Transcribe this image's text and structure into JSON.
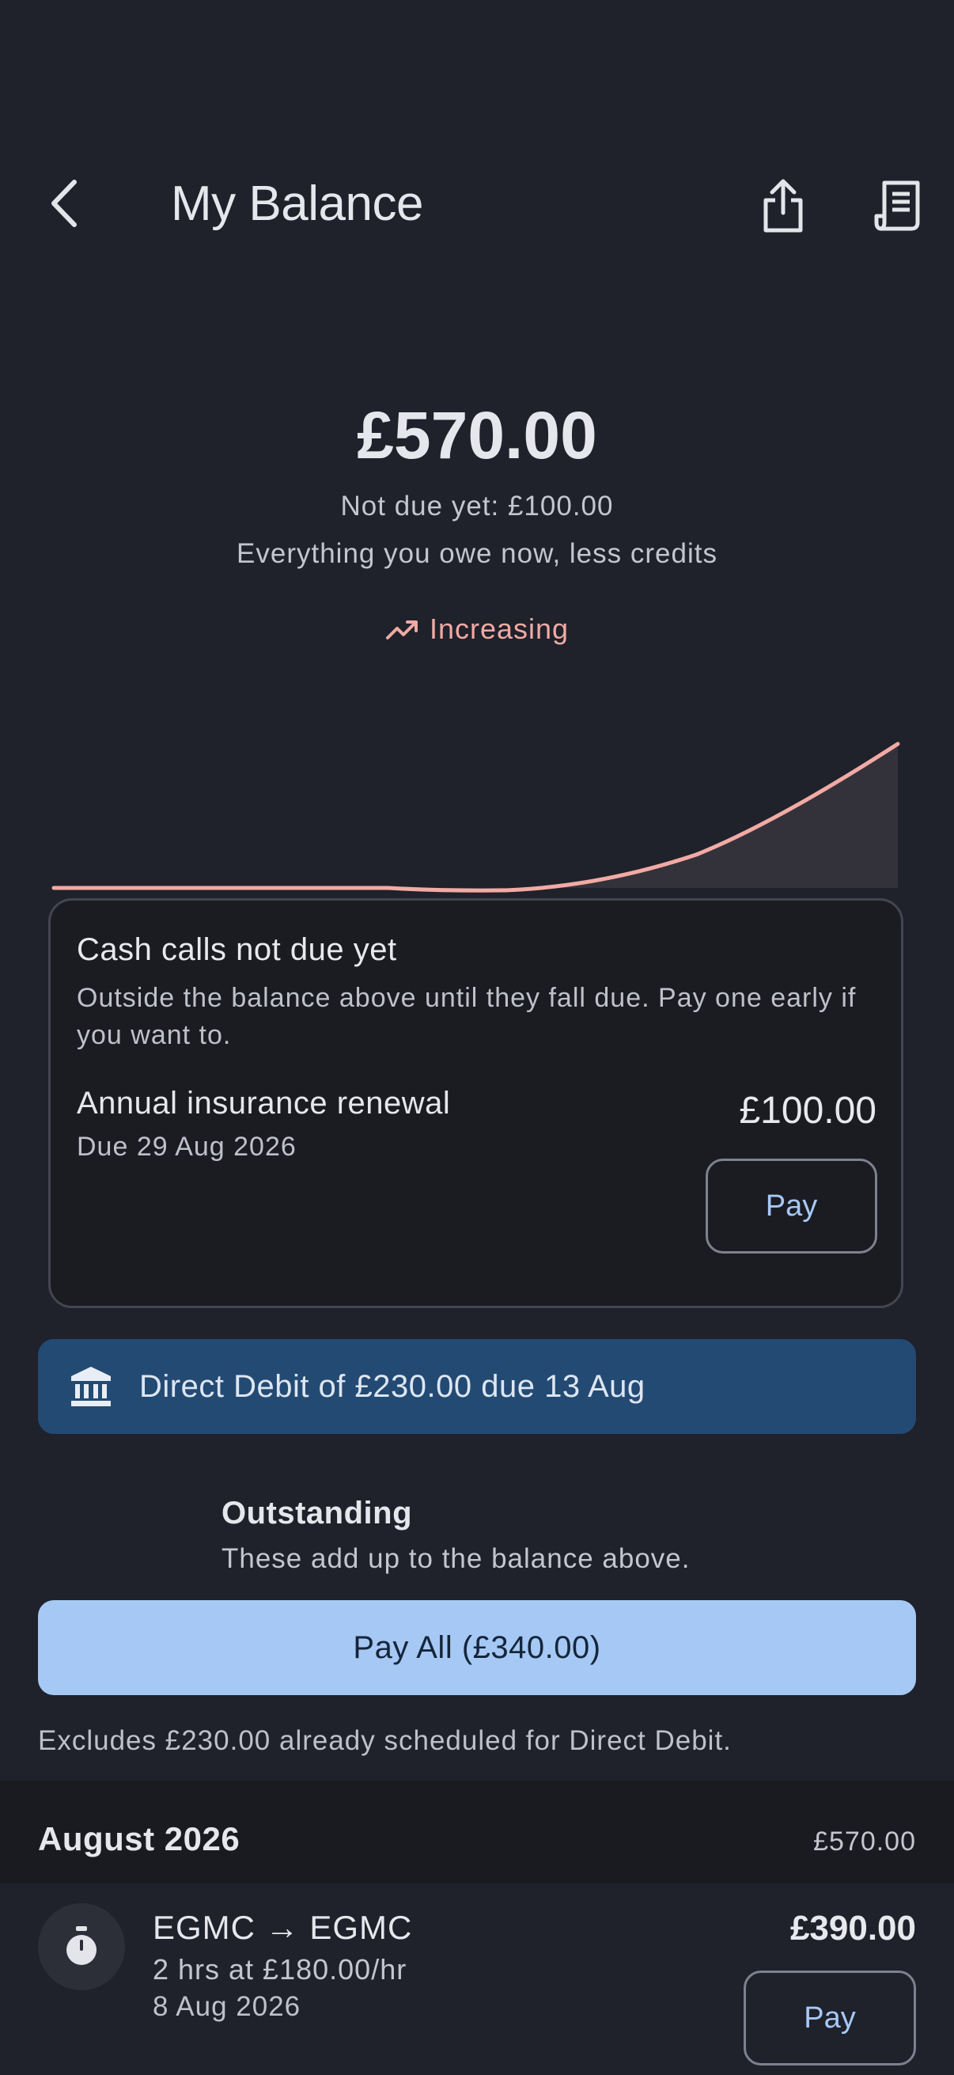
{
  "header": {
    "title": "My Balance",
    "back_icon": "chevron-left-icon",
    "share_icon": "share-icon",
    "statement_icon": "receipt-icon"
  },
  "balance": {
    "amount": "£570.00",
    "not_due": "Not due yet: £100.00",
    "description": "Everything you owe now, less credits",
    "trend": "Increasing",
    "trend_color": "#f0aaa3"
  },
  "cash_calls": {
    "title": "Cash calls not due yet",
    "description": "Outside the balance above until they fall due. Pay one early if you want to.",
    "items": [
      {
        "title": "Annual insurance renewal",
        "due": "Due 29 Aug 2026",
        "amount": "£100.00",
        "pay_label": "Pay"
      }
    ]
  },
  "direct_debit": {
    "icon": "bank-icon",
    "text": "Direct Debit of £230.00 due 13 Aug"
  },
  "outstanding": {
    "title": "Outstanding",
    "subtitle": "These add up to the balance above.",
    "pay_all_label": "Pay All (£340.00)",
    "note": "Excludes £230.00 already scheduled for Direct Debit."
  },
  "months": [
    {
      "name": "August 2026",
      "total": "£570.00",
      "rows": [
        {
          "icon": "stopwatch-icon",
          "title": "EGMC → EGMC",
          "detail": "2 hrs at £180.00/hr",
          "date": "8 Aug 2026",
          "amount": "£390.00",
          "pay_label": "Pay"
        }
      ]
    }
  ],
  "colors": {
    "background": "#1f212b",
    "accent": "#a6c8f4",
    "banner": "#234a73",
    "trend_line": "#f0aaa3"
  }
}
